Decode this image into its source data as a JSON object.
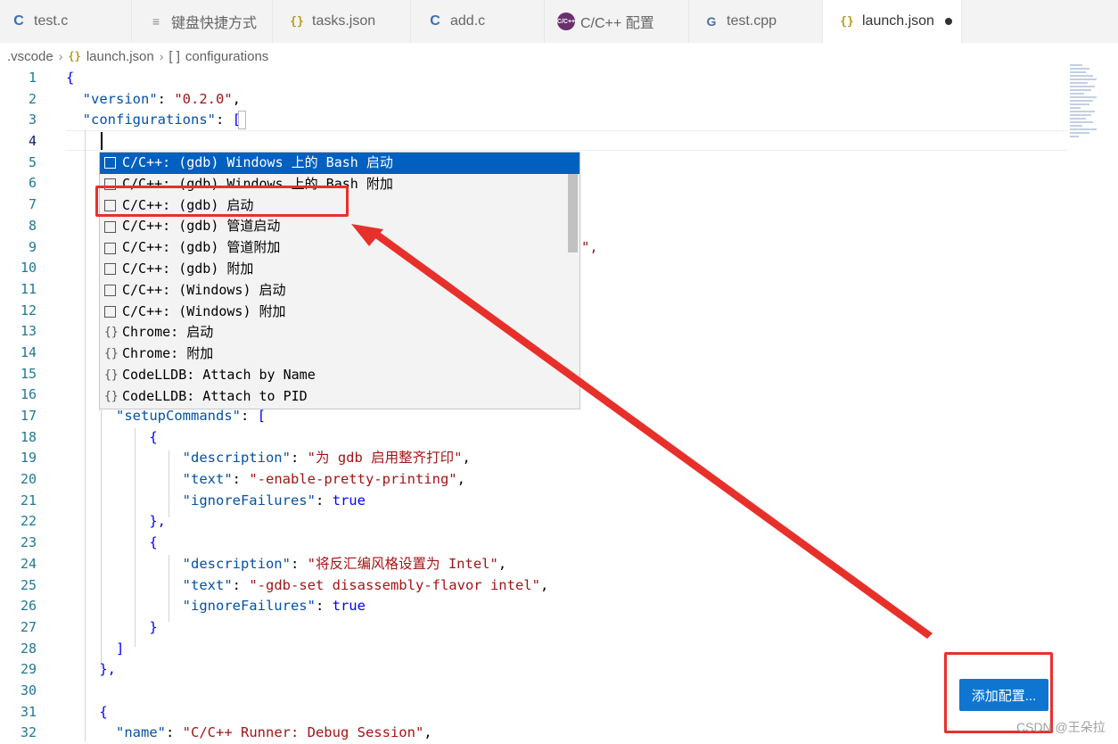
{
  "tabs": [
    {
      "icon": "C",
      "label": "test.c"
    },
    {
      "icon": "≡",
      "label": "键盘快捷方式"
    },
    {
      "icon": "{}",
      "label": "tasks.json"
    },
    {
      "icon": "C",
      "label": "add.c"
    },
    {
      "icon": "C/C++",
      "label": "C/C++ 配置"
    },
    {
      "icon": "G",
      "label": "test.cpp"
    },
    {
      "icon": "{}",
      "label": "launch.json"
    }
  ],
  "breadcrumb": {
    "folder": ".vscode",
    "file_icon": "{}",
    "file": "launch.json",
    "node_icon": "[ ]",
    "node": "configurations"
  },
  "line_numbers": [
    "1",
    "2",
    "3",
    "4",
    "5",
    "6",
    "7",
    "8",
    "9",
    "10",
    "11",
    "12",
    "13",
    "14",
    "15",
    "16",
    "17",
    "18",
    "19",
    "20",
    "21",
    "22",
    "23",
    "24",
    "25",
    "26",
    "27",
    "28",
    "29",
    "30",
    "31",
    "32"
  ],
  "code": {
    "l1": "{",
    "l2_key": "\"version\"",
    "l2_val": "\"0.2.0\"",
    "l3_key": "\"configurations\"",
    "l3_open": "[",
    "l9_tail": "\",",
    "l17_key": "\"setupCommands\"",
    "l17_open": "[",
    "l18": "{",
    "l19_key": "\"description\"",
    "l19_val": "\"为 gdb 启用整齐打印\"",
    "l20_key": "\"text\"",
    "l20_val": "\"-enable-pretty-printing\"",
    "l21_key": "\"ignoreFailures\"",
    "l21_val": "true",
    "l22": "},",
    "l23": "{",
    "l24_key": "\"description\"",
    "l24_val": "\"将反汇编风格设置为 Intel\"",
    "l25_key": "\"text\"",
    "l25_val": "\"-gdb-set disassembly-flavor intel\"",
    "l26_key": "\"ignoreFailures\"",
    "l26_val": "true",
    "l27": "}",
    "l28": "]",
    "l29": "},",
    "l31": "{",
    "l32_key": "\"name\"",
    "l32_val": "\"C/C++ Runner: Debug Session\""
  },
  "suggestions": [
    {
      "icon": "box",
      "label": "C/C++: (gdb) Windows 上的 Bash 启动"
    },
    {
      "icon": "box",
      "label": "C/C++: (gdb) Windows 上的 Bash 附加"
    },
    {
      "icon": "box",
      "label": "C/C++: (gdb) 启动"
    },
    {
      "icon": "box",
      "label": "C/C++: (gdb) 管道启动"
    },
    {
      "icon": "box",
      "label": "C/C++: (gdb) 管道附加"
    },
    {
      "icon": "box",
      "label": "C/C++: (gdb) 附加"
    },
    {
      "icon": "box",
      "label": "C/C++: (Windows) 启动"
    },
    {
      "icon": "box",
      "label": "C/C++: (Windows) 附加"
    },
    {
      "icon": "braces",
      "label": "Chrome: 启动"
    },
    {
      "icon": "braces",
      "label": "Chrome: 附加"
    },
    {
      "icon": "braces",
      "label": "CodeLLDB: Attach by Name"
    },
    {
      "icon": "braces",
      "label": "CodeLLDB: Attach to PID"
    }
  ],
  "suggest_brace_glyph": "{}",
  "add_config_label": "添加配置...",
  "watermark": "CSDN @王朵拉",
  "colors": {
    "accent": "#0060c0",
    "annotation": "#e8302b",
    "button": "#0e75d0"
  }
}
